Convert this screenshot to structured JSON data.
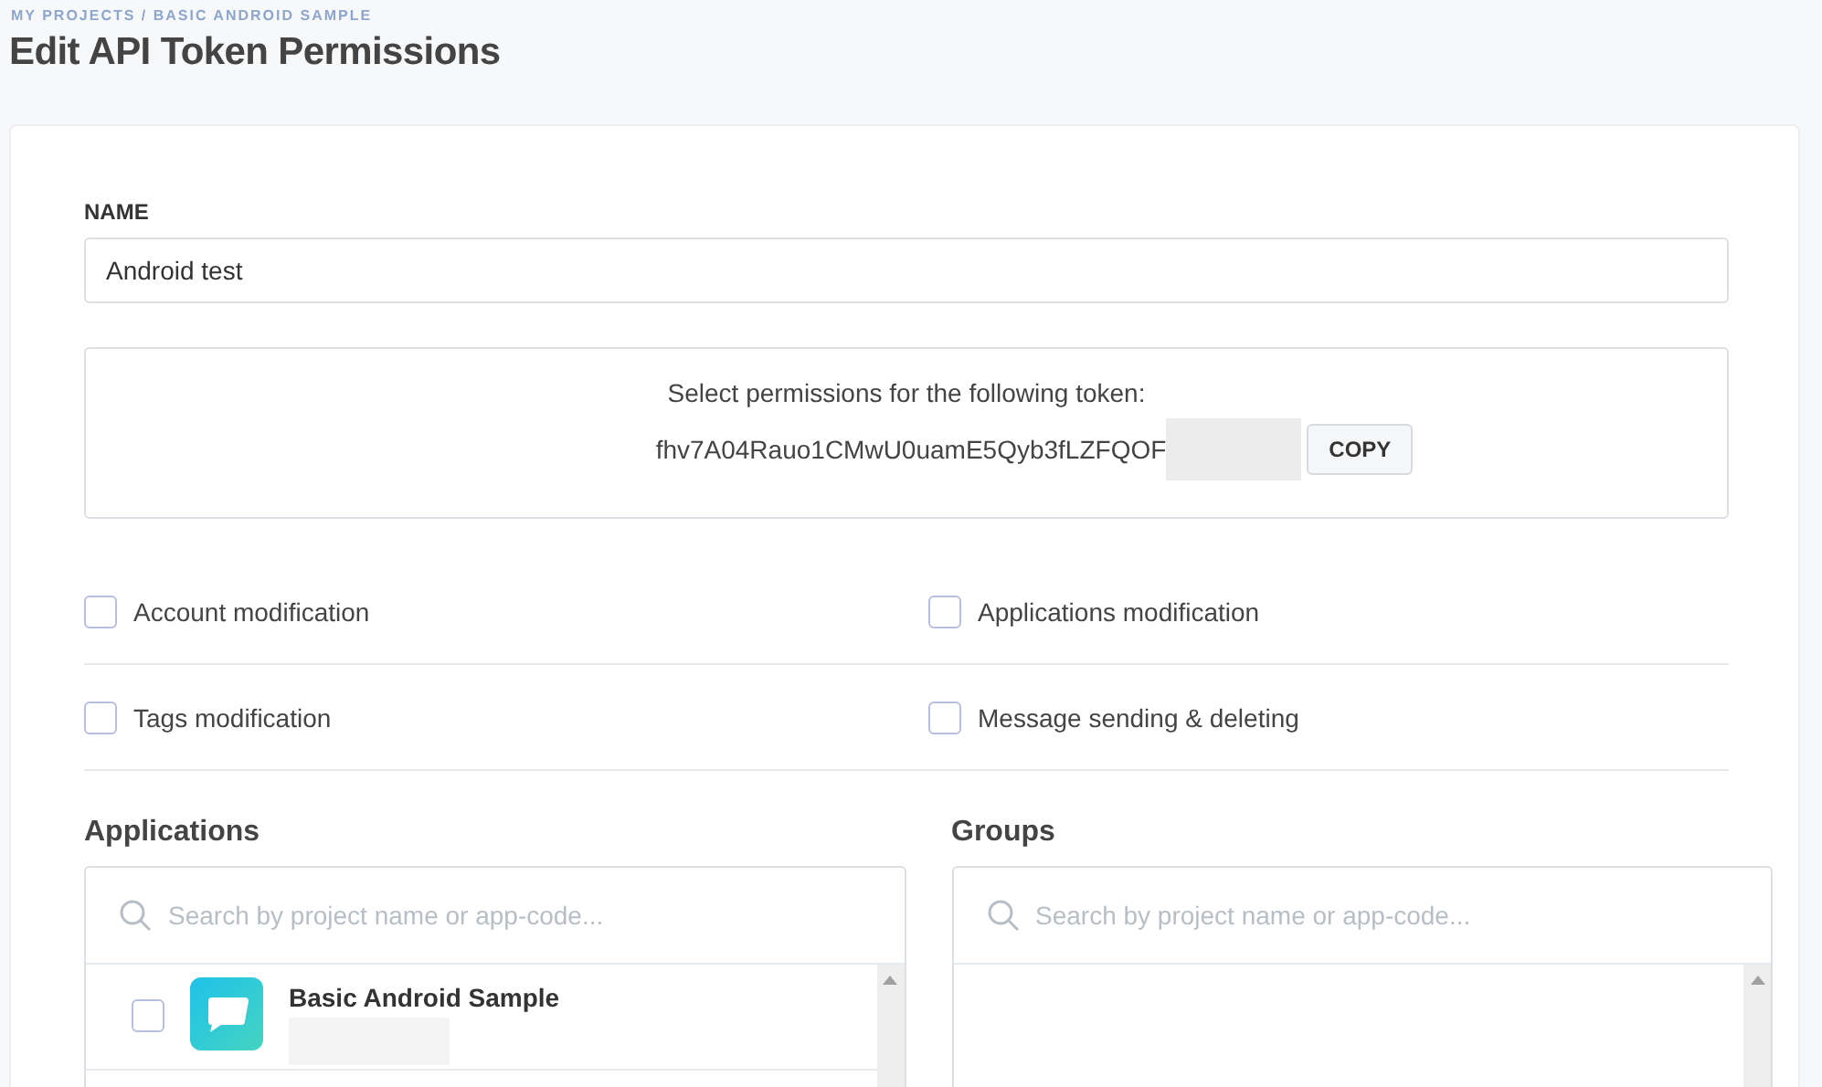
{
  "breadcrumb": "MY PROJECTS / BASIC ANDROID SAMPLE",
  "title": "Edit API Token Permissions",
  "name_field": {
    "label": "NAME",
    "value": "Android test"
  },
  "token_box": {
    "prompt": "Select permissions for the following token:",
    "token": "fhv7A04Rauo1CMwU0uamE5Qyb3fLZFQOF",
    "copy_button": "COPY"
  },
  "permissions": [
    {
      "label": "Account modification",
      "checked": false
    },
    {
      "label": "Applications modification",
      "checked": false
    },
    {
      "label": "Tags modification",
      "checked": false
    },
    {
      "label": "Message sending & deleting",
      "checked": false
    }
  ],
  "applications": {
    "heading": "Applications",
    "search": {
      "placeholder": "Search by project name or app-code..."
    },
    "items": [
      {
        "name": "Basic Android Sample",
        "checked": false
      }
    ]
  },
  "groups": {
    "heading": "Groups",
    "search": {
      "placeholder": "Search by project name or app-code..."
    }
  }
}
